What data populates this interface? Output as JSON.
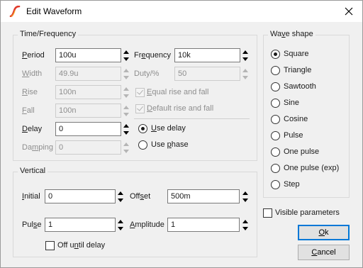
{
  "window": {
    "title": "Edit Waveform"
  },
  "icons": {
    "app": "waveform-app-icon",
    "close": "close-icon"
  },
  "time_frequency": {
    "title": "Time/Frequency",
    "period": {
      "label": "Period",
      "value": "100u"
    },
    "width": {
      "label": "Width",
      "value": "49.9u"
    },
    "rise": {
      "label": "Rise",
      "value": "100n"
    },
    "fall": {
      "label": "Fall",
      "value": "100n"
    },
    "delay": {
      "label": "Delay",
      "value": "0"
    },
    "damping": {
      "label": "Damping",
      "value": "0"
    },
    "frequency": {
      "label": "Frequency",
      "value": "10k"
    },
    "duty": {
      "label": "Duty/%",
      "value": "50"
    },
    "equal_rise_fall": {
      "label": "Equal rise and fall",
      "checked": true,
      "enabled": false
    },
    "default_rise_fall": {
      "label": "Default rise and fall",
      "checked": true,
      "enabled": false
    },
    "use_delay": {
      "label": "Use delay",
      "selected": true
    },
    "use_phase": {
      "label": "Use phase",
      "selected": false
    }
  },
  "vertical": {
    "title": "Vertical",
    "initial": {
      "label": "Initial",
      "value": "0"
    },
    "pulse": {
      "label": "Pulse",
      "value": "1"
    },
    "offset": {
      "label": "Offset",
      "value": "500m"
    },
    "amplitude": {
      "label": "Amplitude",
      "value": "1"
    },
    "off_until_delay": {
      "label": "Off until delay",
      "checked": false
    }
  },
  "wave_shape": {
    "title": "Wave shape",
    "options": [
      {
        "label": "Square",
        "selected": true
      },
      {
        "label": "Triangle",
        "selected": false
      },
      {
        "label": "Sawtooth",
        "selected": false
      },
      {
        "label": "Sine",
        "selected": false
      },
      {
        "label": "Cosine",
        "selected": false
      },
      {
        "label": "Pulse",
        "selected": false
      },
      {
        "label": "One pulse",
        "selected": false
      },
      {
        "label": "One pulse (exp)",
        "selected": false
      },
      {
        "label": "Step",
        "selected": false
      }
    ]
  },
  "visible_parameters": {
    "label": "Visible parameters",
    "checked": false
  },
  "buttons": {
    "ok": "Ok",
    "cancel": "Cancel"
  },
  "colors": {
    "accent": "#0078d7",
    "app_icon_red": "#e03a2b",
    "app_icon_orange": "#f5a623"
  }
}
